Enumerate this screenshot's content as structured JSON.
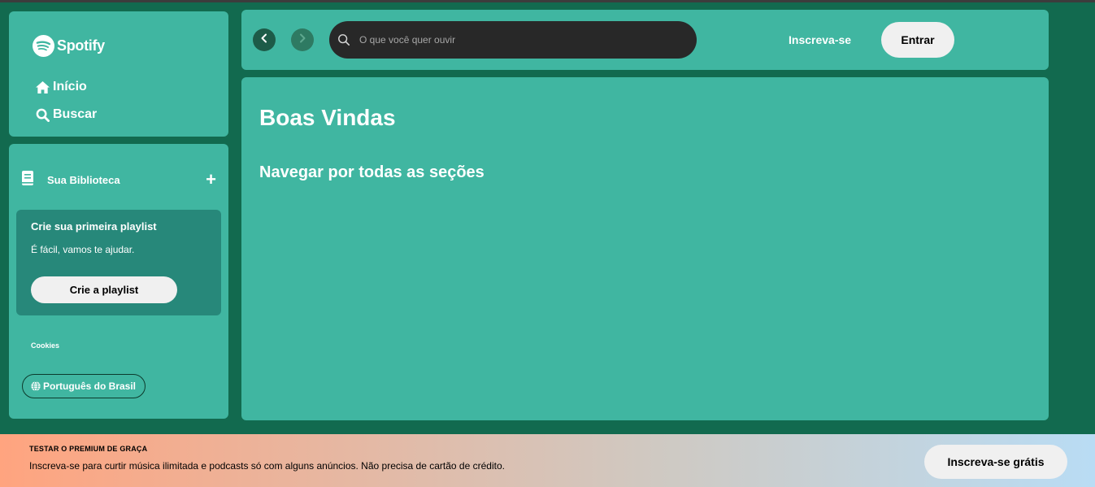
{
  "brand": {
    "name": "Spotify"
  },
  "nav": {
    "items": [
      {
        "label": "Início",
        "icon": "home-icon"
      },
      {
        "label": "Buscar",
        "icon": "search-icon"
      }
    ]
  },
  "library": {
    "title": "Sua Biblioteca",
    "add_label": "+",
    "card": {
      "title": "Crie sua primeira playlist",
      "subtitle": "É fácil, vamos te ajudar.",
      "button_label": "Crie a playlist"
    },
    "cookies_label": "Cookies",
    "language_label": "Português do Brasil"
  },
  "topbar": {
    "search_placeholder": "O que você quer ouvir",
    "signup_label": "Inscreva-se",
    "login_label": "Entrar"
  },
  "main": {
    "title": "Boas Vindas",
    "subtitle": "Navegar por todas as seções"
  },
  "banner": {
    "label": "TESTAR O PREMIUM DE GRAÇA",
    "text": "Inscreva-se para curtir música ilimitada e podcasts só com alguns anúncios. Não precisa de cartão de crédito.",
    "button_label": "Inscreva-se grátis"
  },
  "colors": {
    "background": "#126a4f",
    "panel": "#40b6a1",
    "card": "#27887a",
    "search": "#282828"
  }
}
